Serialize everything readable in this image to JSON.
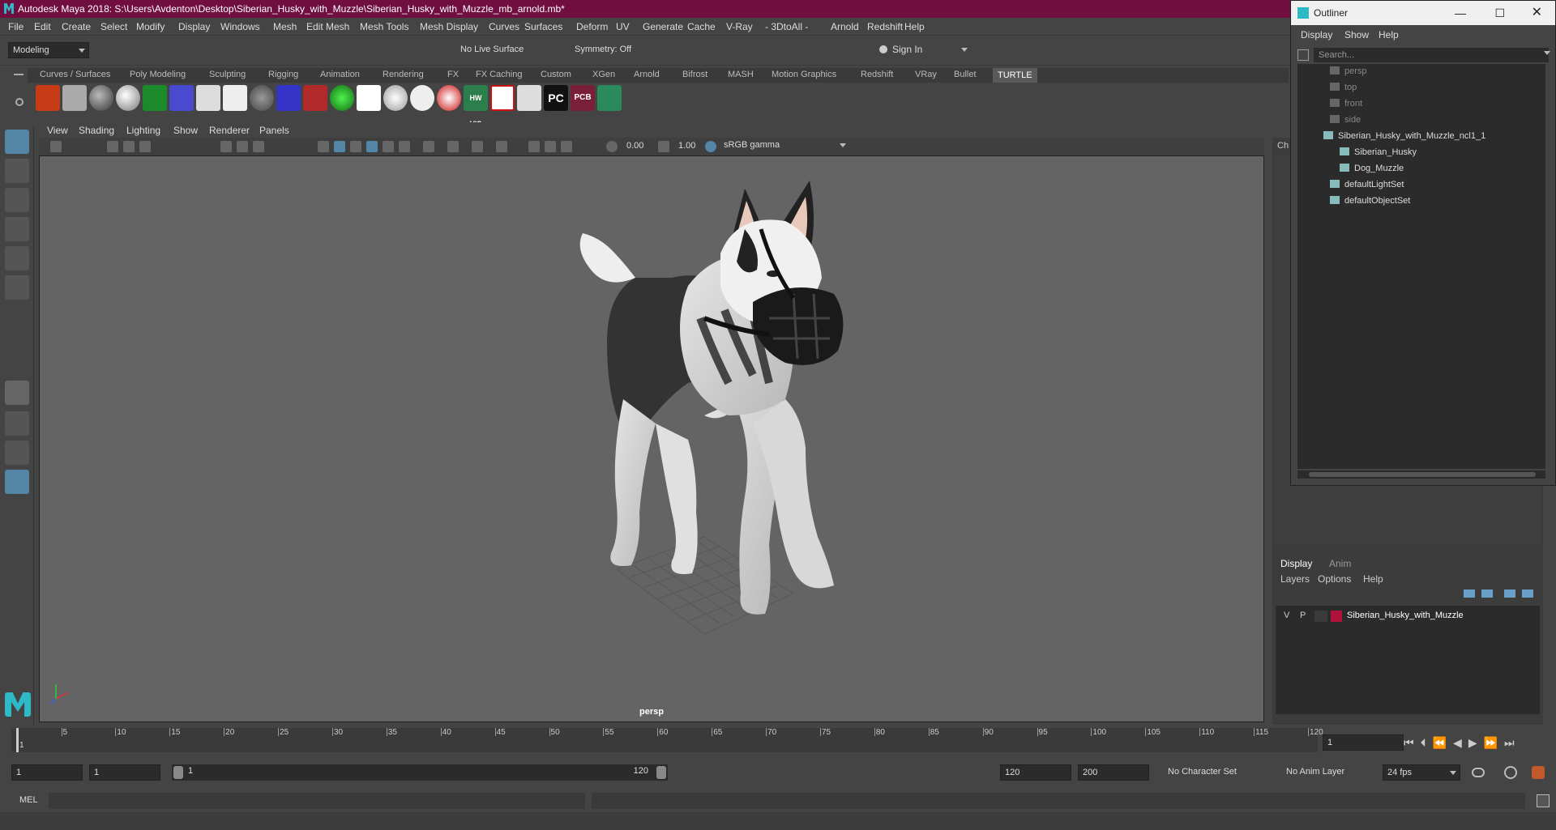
{
  "window": {
    "title": "Autodesk Maya 2018: S:\\Users\\Avdenton\\Desktop\\Siberian_Husky_with_Muzzle\\Siberian_Husky_with_Muzzle_mb_arnold.mb*"
  },
  "menus": [
    "File",
    "Edit",
    "Create",
    "Select",
    "Modify",
    "Display",
    "Windows",
    "Mesh",
    "Edit Mesh",
    "Mesh Tools",
    "Mesh Display",
    "Curves",
    "Surfaces",
    "Deform",
    "UV",
    "Generate",
    "Cache",
    "V-Ray",
    "- 3DtoAll -",
    "Arnold",
    "Redshift",
    "Help"
  ],
  "status": {
    "mode": "Modeling",
    "live_surface": "No Live Surface",
    "symmetry": "Symmetry: Off",
    "sign_in": "Sign In"
  },
  "shelf_tabs": [
    "Curves / Surfaces",
    "Poly Modeling",
    "Sculpting",
    "Rigging",
    "Animation",
    "Rendering",
    "FX",
    "FX Caching",
    "Custom",
    "XGen",
    "Arnold",
    "Bifrost",
    "MASH",
    "Motion Graphics",
    "Redshift",
    "VRay",
    "Bullet",
    "TURTLE"
  ],
  "shelf_active": "TURTLE",
  "shelf_icon_labels": {
    "hw": "HW VIS",
    "pc": "PC",
    "pcb": "PCB"
  },
  "viewport": {
    "menus": [
      "View",
      "Shading",
      "Lighting",
      "Show",
      "Renderer",
      "Panels"
    ],
    "near": "0.00",
    "far": "1.00",
    "color_space": "sRGB gamma",
    "camera": "persp"
  },
  "outliner": {
    "title": "Outliner",
    "menus": [
      "Display",
      "Show",
      "Help"
    ],
    "search_placeholder": "Search...",
    "items": [
      {
        "label": "persp",
        "dim": true
      },
      {
        "label": "top",
        "dim": true
      },
      {
        "label": "front",
        "dim": true
      },
      {
        "label": "side",
        "dim": true
      },
      {
        "label": "Siberian_Husky_with_Muzzle_ncl1_1",
        "dim": false
      },
      {
        "label": "Siberian_Husky",
        "dim": false
      },
      {
        "label": "Dog_Muzzle",
        "dim": false
      },
      {
        "label": "defaultLightSet",
        "dim": false
      },
      {
        "label": "defaultObjectSet",
        "dim": false
      }
    ]
  },
  "channel_box": {
    "tab_hint": "Ch"
  },
  "layers": {
    "tabs": [
      "Display",
      "Anim"
    ],
    "menus": [
      "Layers",
      "Options",
      "Help"
    ],
    "layer": {
      "v": "V",
      "p": "P",
      "name": "Siberian_Husky_with_Muzzle",
      "color": "#b0123a"
    }
  },
  "timeline": {
    "ticks": [
      "5",
      "10",
      "15",
      "20",
      "25",
      "30",
      "35",
      "40",
      "45",
      "50",
      "55",
      "60",
      "65",
      "70",
      "75",
      "80",
      "85",
      "90",
      "95",
      "100",
      "105",
      "110",
      "115",
      "120"
    ],
    "first": "1",
    "current_frame": "1"
  },
  "range": {
    "start": "1",
    "anim_start": "1",
    "slider_start": "1",
    "slider_end": "120",
    "end": "120",
    "anim_end": "200",
    "character_set": "No Character Set",
    "anim_layer": "No Anim Layer",
    "fps": "24 fps"
  },
  "cmd": {
    "label": "MEL"
  },
  "accent": "#5285a6"
}
